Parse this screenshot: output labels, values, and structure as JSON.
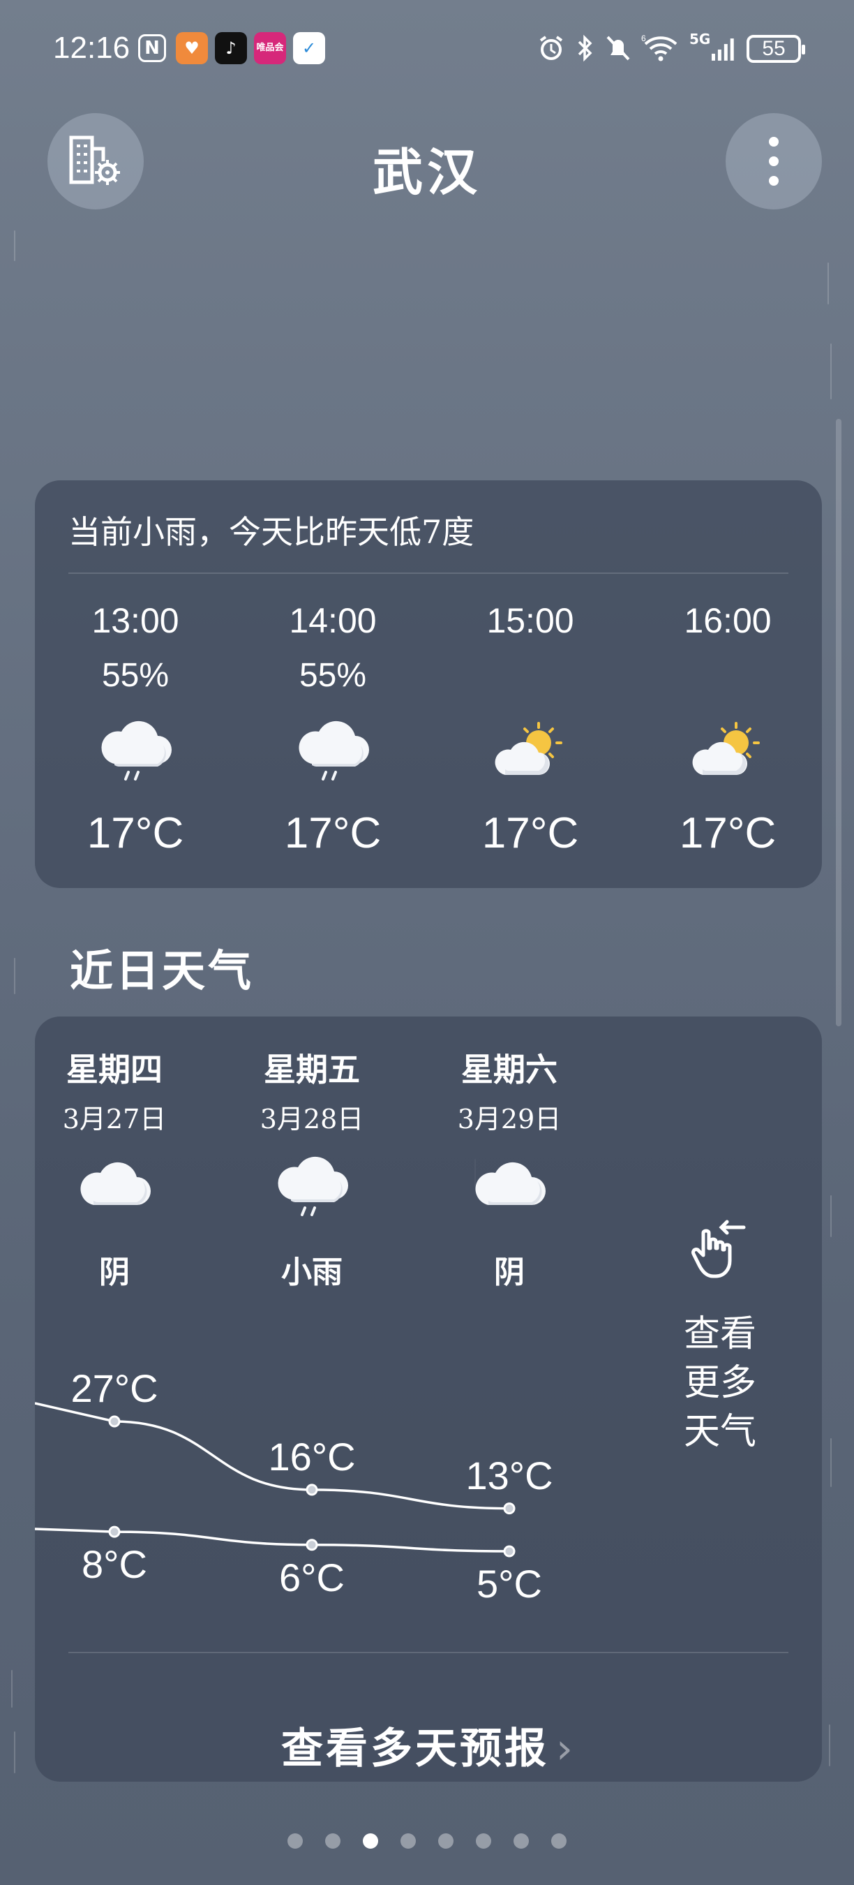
{
  "status_bar": {
    "time": "12:16",
    "network": "5G",
    "battery": "55",
    "apps": [
      "nfc-icon",
      "health-app-icon",
      "tiktok-icon",
      "vip-app-icon",
      "bird-app-icon"
    ],
    "vip_app_text": "唯品会"
  },
  "header": {
    "city": "武汉",
    "left_icon": "city-management-icon",
    "right_icon": "more-menu-icon"
  },
  "hourly_card": {
    "summary": "当前小雨，今天比昨天低7度",
    "hours": [
      {
        "time": "13:00",
        "pop": "55%",
        "icon": "light-rain-icon",
        "temp": "17°C"
      },
      {
        "time": "14:00",
        "pop": "55%",
        "icon": "light-rain-icon",
        "temp": "17°C"
      },
      {
        "time": "15:00",
        "pop": "",
        "icon": "partly-sunny-icon",
        "temp": "17°C"
      },
      {
        "time": "16:00",
        "pop": "",
        "icon": "partly-sunny-icon",
        "temp": "17°C"
      }
    ]
  },
  "recent": {
    "title": "近日天气",
    "days": [
      {
        "weekday": "星期四",
        "date": "3月27日",
        "icon": "cloudy-icon",
        "cond": "阴",
        "high": "27°C",
        "low": "8°C",
        "high_value": 27,
        "low_value": 8
      },
      {
        "weekday": "星期五",
        "date": "3月28日",
        "icon": "light-rain-icon",
        "cond": "小雨",
        "high": "16°C",
        "low": "6°C",
        "high_value": 16,
        "low_value": 6
      },
      {
        "weekday": "星期六",
        "date": "3月29日",
        "icon": "cloudy-icon",
        "cond": "阴",
        "high": "13°C",
        "low": "5°C",
        "high_value": 13,
        "low_value": 5
      }
    ],
    "more_side": "查看更多天气",
    "more_side_icon": "swipe-left-hand-icon",
    "forecast_button": "查看多天预报"
  },
  "pager": {
    "count": 8,
    "active": 3
  },
  "colors": {
    "sun": "#f5c542",
    "card": "#3e485a",
    "background": "#66717f"
  }
}
